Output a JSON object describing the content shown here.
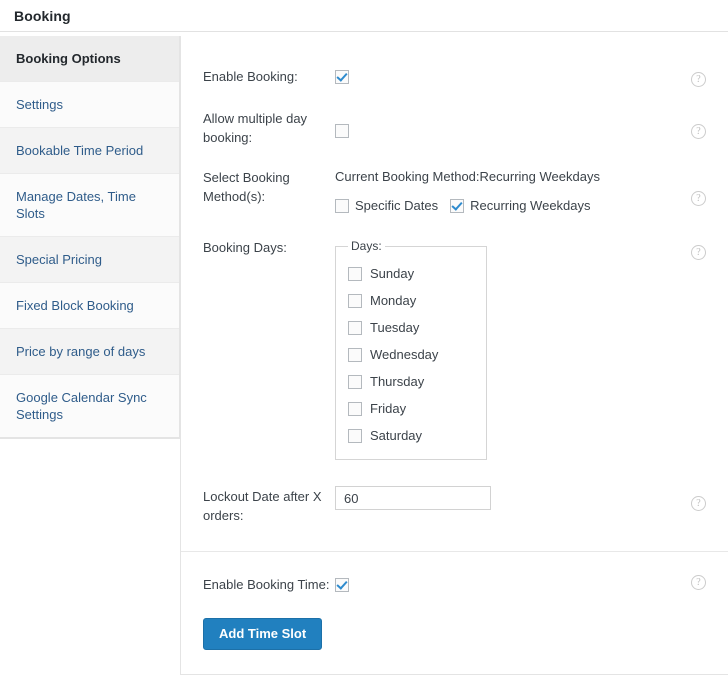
{
  "header": {
    "title": "Booking"
  },
  "sidebar": {
    "items": [
      {
        "label": "Booking Options",
        "active": true
      },
      {
        "label": "Settings",
        "active": false
      },
      {
        "label": "Bookable Time Period",
        "active": false
      },
      {
        "label": "Manage Dates, Time Slots",
        "active": false
      },
      {
        "label": "Special Pricing",
        "active": false
      },
      {
        "label": "Fixed Block Booking",
        "active": false
      },
      {
        "label": "Price by range of days",
        "active": false
      },
      {
        "label": "Google Calendar Sync Settings",
        "active": false
      }
    ]
  },
  "main": {
    "enable_booking": {
      "label": "Enable Booking:",
      "checked": true,
      "help": "?"
    },
    "allow_multiple_day": {
      "label": "Allow multiple day booking:",
      "checked": false,
      "help": "?"
    },
    "booking_method": {
      "label": "Select Booking Method(s):",
      "current_text": "Current Booking Method:Recurring Weekdays",
      "options": [
        {
          "label": "Specific Dates",
          "checked": false
        },
        {
          "label": "Recurring Weekdays",
          "checked": true
        }
      ],
      "help": "?"
    },
    "booking_days": {
      "label": "Booking Days:",
      "legend": "Days:",
      "days": [
        {
          "label": "Sunday",
          "checked": false
        },
        {
          "label": "Monday",
          "checked": false
        },
        {
          "label": "Tuesday",
          "checked": false
        },
        {
          "label": "Wednesday",
          "checked": false
        },
        {
          "label": "Thursday",
          "checked": false
        },
        {
          "label": "Friday",
          "checked": false
        },
        {
          "label": "Saturday",
          "checked": false
        }
      ],
      "help": "?"
    },
    "lockout_date": {
      "label": "Lockout Date after X orders:",
      "value": "60",
      "placeholder": "",
      "help": "?"
    },
    "enable_booking_time": {
      "label": "Enable Booking Time:",
      "checked": true,
      "help": "?"
    },
    "add_time_slot_button": "Add Time Slot"
  },
  "colors": {
    "accent": "#2180bf",
    "link": "#2f5c8a",
    "checkbox_tick": "#2e8bce"
  }
}
